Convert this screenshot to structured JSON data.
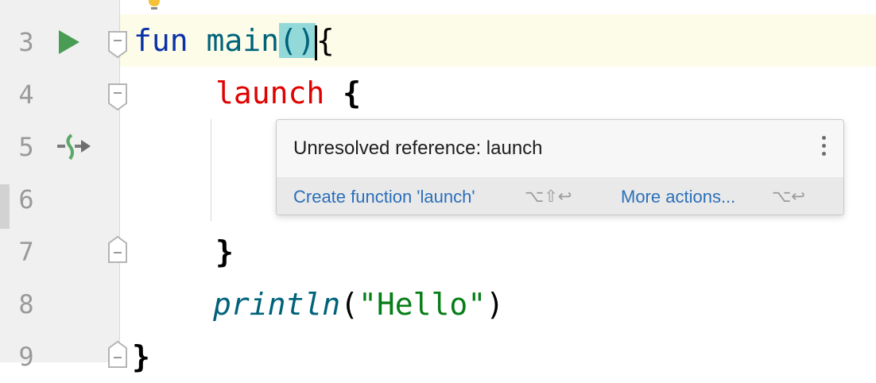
{
  "editor": {
    "lines": [
      {
        "num": "3"
      },
      {
        "num": "4"
      },
      {
        "num": "5"
      },
      {
        "num": "6"
      },
      {
        "num": "7"
      },
      {
        "num": "8"
      },
      {
        "num": "9"
      }
    ],
    "code": {
      "l3_kw": "fun",
      "l3_fn": "main",
      "l3_parens": "()",
      "l3_brace": "{",
      "l4_call": "launch",
      "l4_brace": "{",
      "l7_brace": "}",
      "l8_fn": "println",
      "l8_open": "(",
      "l8_str": "\"Hello\"",
      "l8_close": ")",
      "l9_brace": "}"
    },
    "gutter_icons": {
      "run": "run-icon",
      "suspend": "suspend-call-icon",
      "bulb": "lightbulb-icon"
    }
  },
  "popup": {
    "message": "Unresolved reference: launch",
    "action_primary": "Create function 'launch'",
    "shortcut_primary": "⌥⇧↩",
    "action_more": "More actions...",
    "shortcut_more": "⌥↩"
  },
  "colors": {
    "keyword": "#0b31a8",
    "function": "#00627a",
    "error": "#e00000",
    "string": "#067d17",
    "link": "#2a6fba"
  }
}
